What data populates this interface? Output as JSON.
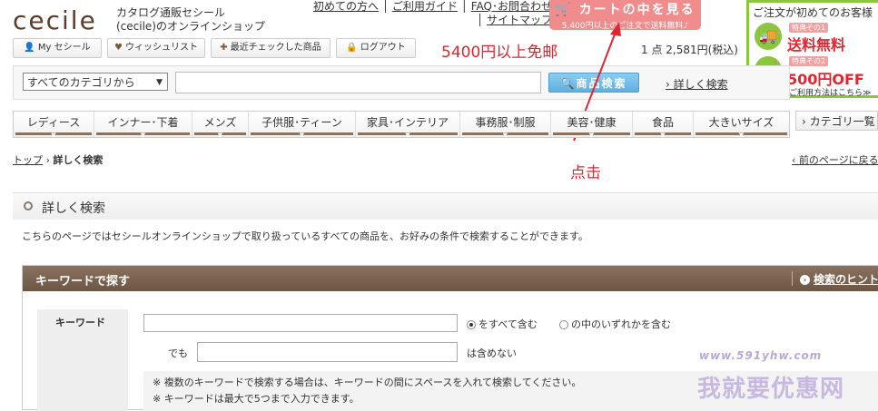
{
  "header": {
    "logo": "cecile",
    "tagline_1": "カタログ通販セシール",
    "tagline_2": "(cecile)のオンラインショップ",
    "links": [
      "初めての方へ",
      "ご利用ガイド",
      "FAQ･お問合わせ",
      "サイトマップ"
    ],
    "cart_button": "カートの中を見る",
    "cart_button_sub": "5,400円以上のご注文で送料無料♪",
    "cart_info": "1 点 2,581円(税込)"
  },
  "promo": {
    "title": "ご注文が初めてのお客様",
    "badge1": "特典その1",
    "offer1": "送料無料",
    "badge2": "特典その2",
    "offer2": "500円OFF",
    "footer": "ご利用方法はこちら≫"
  },
  "user_buttons": [
    "My セシール",
    "ウィッシュリスト",
    "最近チェックした商品",
    "ログアウト"
  ],
  "annotations": {
    "free_shipping": "5400円以上免邮",
    "click": "点击",
    "arrow_color": "#e0262f"
  },
  "search": {
    "category": "すべてのカテゴリから",
    "button": "商品検索",
    "detail_link": "詳しく検索"
  },
  "nav": [
    "レディース",
    "インナー･下着",
    "メンズ",
    "子供服･ティーン",
    "家具･インテリア",
    "事務服･制服",
    "美容･健康",
    "食品",
    "大きいサイズ"
  ],
  "category_list": "カテゴリ一覧",
  "breadcrumb": {
    "home": "トップ",
    "current": "詳しく検索"
  },
  "back_link": "前のページに戻る",
  "section": {
    "title": "詳しく検索",
    "description": "こちらのページではセシールオンラインショップで取り扱っているすべての商品を、お好みの条件で検索することができます。"
  },
  "keyword_box": {
    "header": "キーワードで探す",
    "hint": "検索のヒント",
    "label": "キーワード",
    "radio_all": "をすべて含む",
    "radio_any": "の中のいずれかを含む",
    "but_label": "でも",
    "exclude": "は含めない",
    "note1": "※ 複数のキーワードで検索する場合は、キーワードの間にスペースを入れて検索してください。",
    "note2": "※ キーワードは最大で5つまで入力できます。"
  },
  "watermark": {
    "url": "www.591yhw.com",
    "text": "我就要优惠网"
  }
}
